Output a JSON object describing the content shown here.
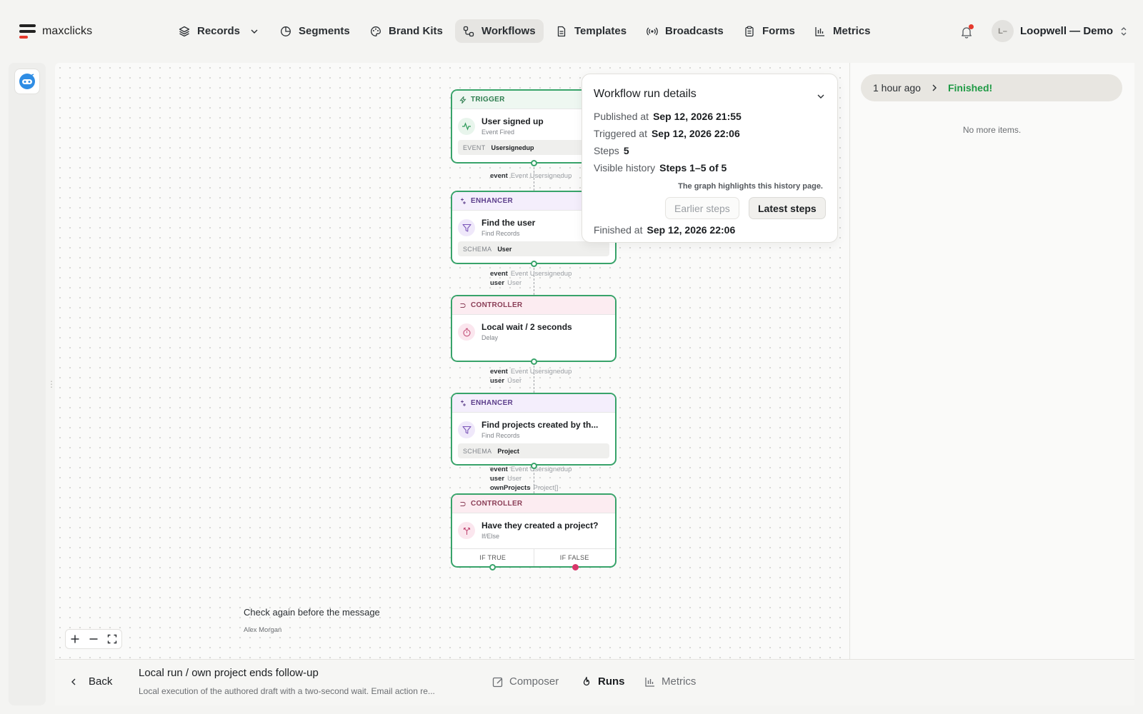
{
  "app": {
    "brand": "maxclicks"
  },
  "nav": [
    {
      "label": "Records",
      "icon": "layers-icon"
    },
    {
      "label": "Segments",
      "icon": "pie-icon"
    },
    {
      "label": "Brand Kits",
      "icon": "palette-icon"
    },
    {
      "label": "Workflows",
      "icon": "workflow-icon",
      "active": true
    },
    {
      "label": "Templates",
      "icon": "document-icon"
    },
    {
      "label": "Broadcasts",
      "icon": "broadcast-icon"
    },
    {
      "label": "Forms",
      "icon": "clipboard-icon"
    },
    {
      "label": "Metrics",
      "icon": "bar-chart-icon"
    }
  ],
  "account": {
    "initials": "L–",
    "name": "Loopwell — Demo"
  },
  "workflow": {
    "nodes": [
      {
        "category": "TRIGGER",
        "title": "User signed up",
        "subtitle": "Event Fired",
        "chip_key": "EVENT",
        "chip_value": "Usersignedup"
      },
      {
        "category": "ENHANCER",
        "title": "Find the user",
        "subtitle": "Find Records",
        "chip_key": "SCHEMA",
        "chip_value": "User"
      },
      {
        "category": "CONTROLLER",
        "title": "Local wait / 2 seconds",
        "subtitle": "Delay"
      },
      {
        "category": "ENHANCER",
        "title": "Find projects created by th...",
        "subtitle": "Find Records",
        "chip_key": "SCHEMA",
        "chip_value": "Project"
      },
      {
        "category": "CONTROLLER",
        "title": "Have they created a project?",
        "subtitle": "If/Else",
        "branch_true": "IF TRUE",
        "branch_false": "IF FALSE"
      }
    ],
    "edges": [
      [
        {
          "key": "event",
          "value": "Event Usersignedup"
        }
      ],
      [
        {
          "key": "event",
          "value": "Event Usersignedup"
        },
        {
          "key": "user",
          "value": "User"
        }
      ],
      [
        {
          "key": "event",
          "value": "Event Usersignedup"
        },
        {
          "key": "user",
          "value": "User"
        }
      ],
      [
        {
          "key": "event",
          "value": "Event Usersignedup"
        },
        {
          "key": "user",
          "value": "User"
        },
        {
          "key": "ownProjects",
          "value": "Project[]"
        }
      ]
    ]
  },
  "run_details": {
    "title": "Workflow run details",
    "published_label": "Published at",
    "published_value": "Sep 12, 2026 21:55",
    "triggered_label": "Triggered at",
    "triggered_value": "Sep 12, 2026 22:06",
    "steps_label": "Steps",
    "steps_value": "5",
    "history_label": "Visible history",
    "history_value": "Steps 1–5 of 5",
    "hint": "The graph highlights this history page.",
    "earlier_button": "Earlier steps",
    "latest_button": "Latest steps",
    "finished_label": "Finished at",
    "finished_value": "Sep 12, 2026 22:06"
  },
  "runs_panel": {
    "time": "1 hour ago",
    "status": "Finished!",
    "status_color": "#1f9a45",
    "empty": "No more items."
  },
  "note": {
    "title": "Check again before the message",
    "author": "Alex Morgan"
  },
  "bottom": {
    "back": "Back",
    "title": "Local run / own project ends follow-up",
    "description": "Local execution of the authored draft with a two-second wait. Email action re...",
    "tabs": [
      {
        "label": "Composer",
        "icon": "composer-icon"
      },
      {
        "label": "Runs",
        "icon": "runs-icon",
        "active": true
      },
      {
        "label": "Metrics",
        "icon": "bar-chart-icon"
      }
    ]
  },
  "colors": {
    "accent_green": "#38a36a",
    "false_port": "#d8366a",
    "notification": "#e5392d"
  }
}
